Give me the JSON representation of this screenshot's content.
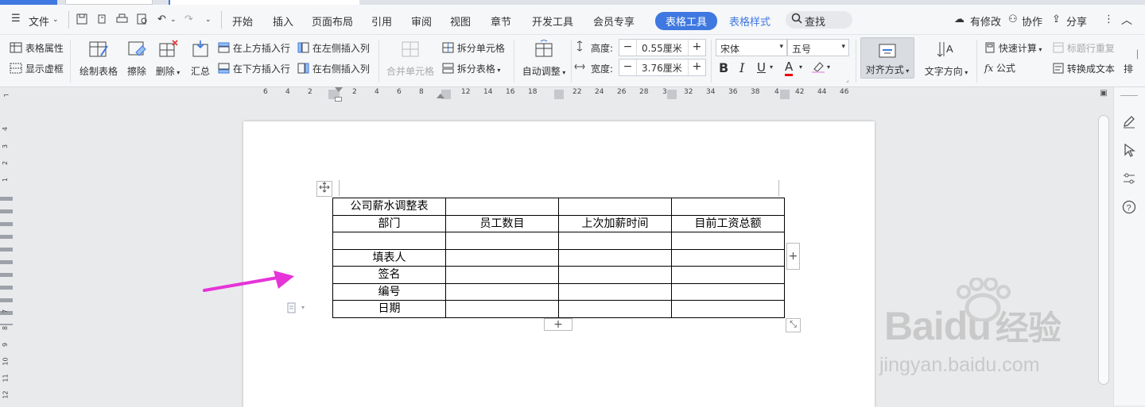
{
  "menu": {
    "file_label": "文件",
    "tabs": [
      "开始",
      "插入",
      "页面布局",
      "引用",
      "审阅",
      "视图",
      "章节",
      "开发工具",
      "会员专享",
      "表格工具",
      "表格样式"
    ],
    "active_tab": "表格工具",
    "search_label": "查找",
    "right": {
      "changes": "有修改",
      "collab": "协作",
      "share": "分享"
    }
  },
  "ribbon": {
    "table_props": "表格属性",
    "show_gridlines": "显示虚框",
    "draw_table": "绘制表格",
    "erase": "擦除",
    "delete": "删除",
    "summary": "汇总",
    "insert_row_above": "在上方插入行",
    "insert_row_below": "在下方插入行",
    "insert_col_left": "在左侧插入列",
    "insert_col_right": "在右侧插入列",
    "merge_cells": "合并单元格",
    "split_cells": "拆分单元格",
    "split_table": "拆分表格",
    "auto_fit": "自动调整",
    "height_label": "高度:",
    "height_value": "0.55厘米",
    "width_label": "宽度:",
    "width_value": "3.76厘米",
    "font_name": "宋体",
    "font_size": "五号",
    "align": "对齐方式",
    "text_direction": "文字方向",
    "quick_calc": "快速计算",
    "repeat_header": "标题行重复",
    "formula": "公式",
    "to_text": "转换成文本",
    "arrange": "排"
  },
  "ruler": {
    "h_ticks": [
      "6",
      "4",
      "2",
      "2",
      "4",
      "6",
      "8",
      "12",
      "14",
      "16",
      "18",
      "22",
      "24",
      "26",
      "28",
      "3",
      "32",
      "34",
      "36",
      "38",
      "4",
      "42",
      "44",
      "46"
    ],
    "v_ticks": [
      "4",
      "3",
      "2",
      "1",
      "7",
      "8",
      "9",
      "10",
      "11",
      "12"
    ]
  },
  "table": {
    "rows": [
      [
        "公司薪水调整表",
        "",
        "",
        ""
      ],
      [
        "部门",
        "员工数目",
        "上次加薪时间",
        "目前工资总额"
      ],
      [
        "",
        "",
        "",
        ""
      ],
      [
        "填表人",
        "",
        "",
        ""
      ],
      [
        "签名",
        "",
        "",
        ""
      ],
      [
        "编号",
        "",
        "",
        ""
      ],
      [
        "日期",
        "",
        "",
        ""
      ]
    ]
  },
  "watermark": {
    "brand": "Baidu",
    "cn": "经验",
    "url": "jingyan.baidu.com"
  },
  "colors": {
    "accent": "#3f78e0",
    "arrow": "#e534d8"
  }
}
